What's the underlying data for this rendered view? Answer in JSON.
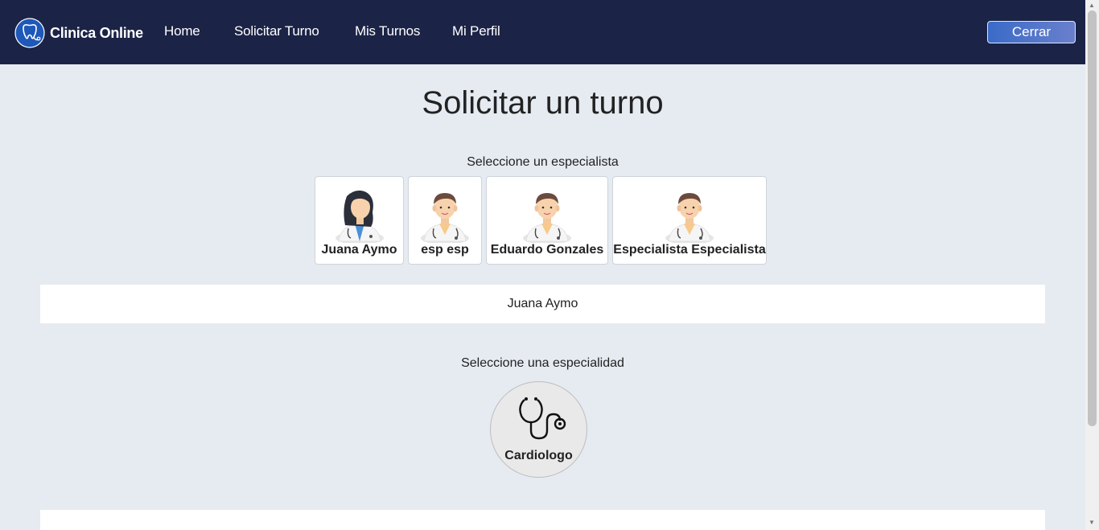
{
  "navbar": {
    "brand": "Clinica Online",
    "links": [
      "Home",
      "Solicitar Turno",
      "Mis Turnos",
      "Mi Perfil"
    ],
    "logout_label": "Cerrar"
  },
  "page": {
    "title": "Solicitar un turno",
    "specialist_prompt": "Seleccione un especialista",
    "specialty_prompt": "Seleccione una especialidad"
  },
  "specialists": [
    {
      "name": "Juana Aymo",
      "avatar": "female-doctor-icon"
    },
    {
      "name": "esp esp",
      "avatar": "male-doctor-icon"
    },
    {
      "name": "Eduardo Gonzales",
      "avatar": "male-doctor-icon"
    },
    {
      "name": "Especialista Especialista",
      "avatar": "male-doctor-icon"
    }
  ],
  "selected_specialist": "Juana Aymo",
  "specialties": [
    {
      "name": "Cardiologo",
      "icon": "stethoscope-icon"
    }
  ],
  "colors": {
    "navbar_bg": "#1b2346",
    "page_bg": "#e6ebf2",
    "logout_button": "#3a6bc7"
  }
}
